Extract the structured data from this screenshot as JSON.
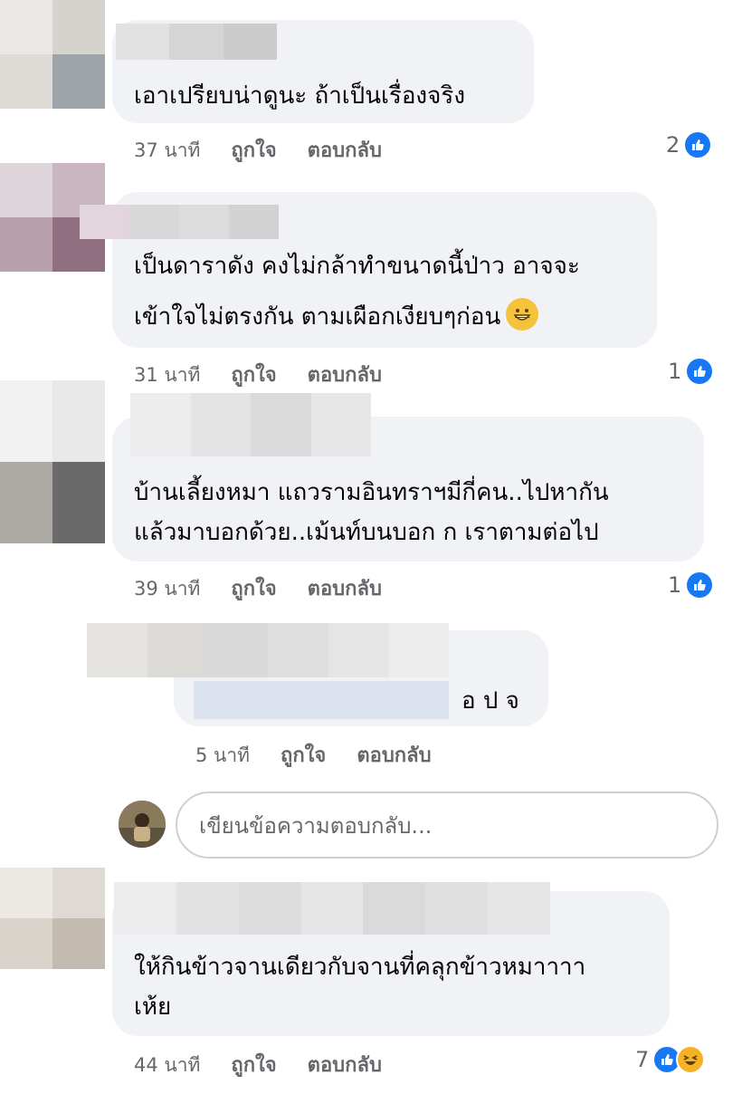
{
  "comments": [
    {
      "text_lines": [
        "เอาเปรียบน่าดูนะ ถ้าเป็นเรื่องจริง"
      ],
      "time": "37 นาที",
      "like_label": "ถูกใจ",
      "reply_label": "ตอบกลับ",
      "reaction_count": "2"
    },
    {
      "text_lines": [
        "เป็นดาราดัง คงไม่กล้าทำขนาดนี้ป่าว อาจจะ",
        "เข้าใจไม่ตรงกัน ตามเผือกเงียบๆก่อน"
      ],
      "time": "31 นาที",
      "like_label": "ถูกใจ",
      "reply_label": "ตอบกลับ",
      "reaction_count": "1",
      "emoji": "grinning-face"
    },
    {
      "text_lines": [
        "บ้านเลี้ยงหมา แถวรามอินทราฯมีกี่คน..ไปหากัน",
        "แล้วมาบอกด้วย..เม้นท์บนบอก ก   เราตามต่อไป"
      ],
      "time": "39 นาที",
      "like_label": "ถูกใจ",
      "reply_label": "ตอบกลับ",
      "reaction_count": "1"
    },
    {
      "text_lines": [
        "อ ป จ"
      ],
      "time": "5 นาที",
      "like_label": "ถูกใจ",
      "reply_label": "ตอบกลับ"
    },
    {
      "text_lines": [
        "ให้กินข้าวจานเดียวกับจานที่คลุกข้าวหมาาาา",
        "เห้ย"
      ],
      "time": "44 นาที",
      "like_label": "ถูกใจ",
      "reply_label": "ตอบกลับ",
      "reaction_count": "7"
    }
  ],
  "reply_box": {
    "placeholder": "เขียนข้อความตอบกลับ..."
  },
  "icons": {
    "like": "thumbs-up-icon",
    "haha": "laughing-face-icon",
    "grin": "grinning-face-emoji"
  },
  "colors": {
    "bubble": "#f0f2f5",
    "like_blue": "#1877f2",
    "meta_gray": "#65676b"
  }
}
